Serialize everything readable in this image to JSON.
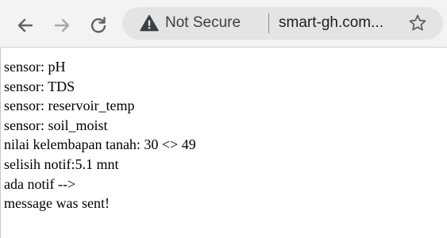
{
  "browser": {
    "security_label": "Not Secure",
    "url": "smart-gh.com...",
    "back_icon": "back-arrow-icon",
    "forward_icon": "forward-arrow-icon",
    "reload_icon": "reload-icon",
    "warning_icon": "warning-triangle-icon",
    "bookmark_icon": "star-icon"
  },
  "page": {
    "lines": [
      "sensor: pH",
      "sensor: TDS",
      "sensor: reservoir_temp",
      "sensor: soil_moist",
      "nilai kelembapan tanah: 30 <> 49",
      "selisih notif:5.1 mnt",
      "ada notif -->",
      "message was sent!"
    ]
  },
  "colors": {
    "toolbar_bg": "#f1f3f4",
    "omnibox_bg": "#e2e4e6",
    "icon": "#5f6368",
    "text": "#000000"
  }
}
